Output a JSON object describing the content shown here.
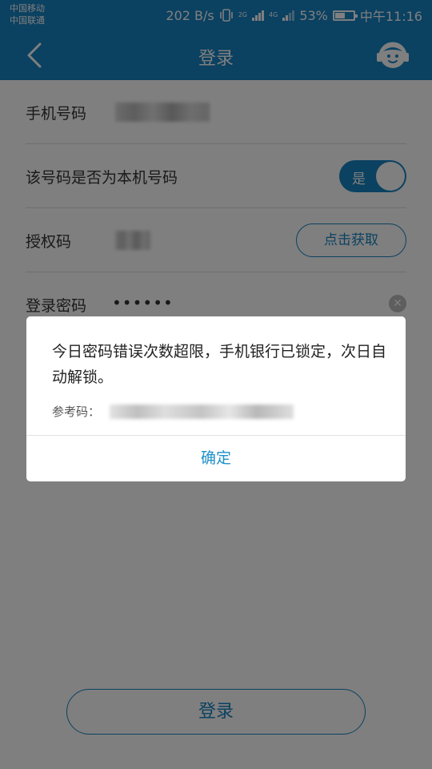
{
  "status_bar": {
    "carrier_1": "中国移动",
    "carrier_2": "中国联通",
    "net_speed": "202 B/s",
    "sim1_type": "2G",
    "sim2_type": "4G",
    "battery": "53%",
    "time": "中午11:16"
  },
  "header": {
    "title": "登录"
  },
  "form": {
    "phone_label": "手机号码",
    "is_local_label": "该号码是否为本机号码",
    "toggle_label": "是",
    "toggle_on": true,
    "auth_label": "授权码",
    "get_code_label": "点击获取",
    "password_label": "登录密码",
    "password_mask": "••••••"
  },
  "login_button": "登录",
  "dialog": {
    "message": "今日密码错误次数超限，手机银行已锁定，次日自动解锁。",
    "ref_label": "参考码：",
    "ok_label": "确定"
  },
  "colors": {
    "primary": "#1783c2",
    "overlay": "rgba(0,0,0,0.5)"
  }
}
